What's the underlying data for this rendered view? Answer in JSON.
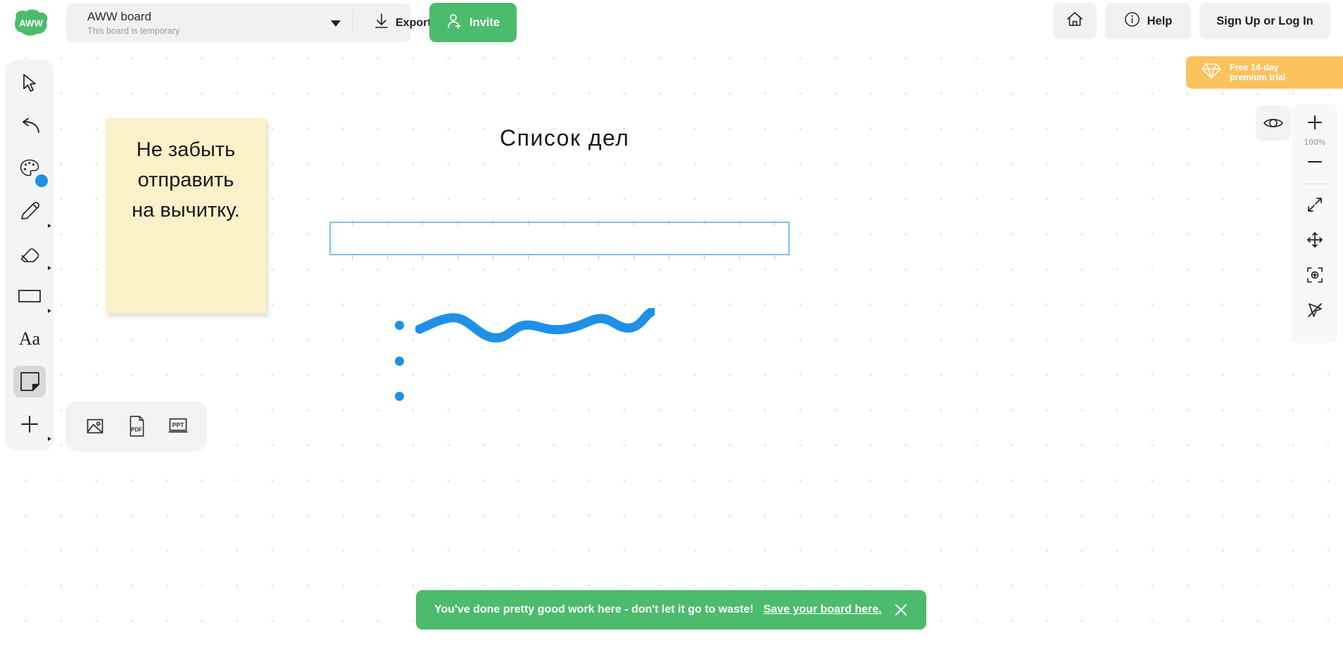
{
  "header": {
    "logo_text": "AWW",
    "board_title": "AWW board",
    "board_subtitle": "This board is temporary",
    "dropdown_icon": "chevron-down-icon",
    "export_label": "Export board",
    "export_icon": "download-icon",
    "invite_label": "Invite",
    "invite_icon": "add-user-icon",
    "home_icon": "home-icon",
    "help_label": "Help",
    "help_icon": "info-circle-icon",
    "signin_label": "Sign Up or Log In"
  },
  "premium": {
    "line1": "Free 14-day",
    "line2": "premium trial",
    "icon": "diamond-icon",
    "color": "#fbc25e"
  },
  "left_toolbar": {
    "tools": [
      {
        "name": "select-tool",
        "icon": "cursor-arrow-icon",
        "active": false,
        "has_arrow": false
      },
      {
        "name": "undo-tool",
        "icon": "undo-arrow-icon",
        "active": false,
        "has_arrow": false
      },
      {
        "name": "color-palette-tool",
        "icon": "palette-icon",
        "active": false,
        "has_arrow": false,
        "swatch_color": "#1e90e8"
      },
      {
        "name": "pencil-tool",
        "icon": "pencil-icon",
        "active": false,
        "has_arrow": true
      },
      {
        "name": "eraser-tool",
        "icon": "eraser-icon",
        "active": false,
        "has_arrow": true
      },
      {
        "name": "shape-tool",
        "icon": "rectangle-icon",
        "active": false,
        "has_arrow": true
      },
      {
        "name": "text-tool",
        "icon": "text-aa-icon",
        "active": false,
        "has_arrow": false,
        "label": "Aa"
      },
      {
        "name": "sticky-note-tool",
        "icon": "sticky-note-icon",
        "active": true,
        "has_arrow": false
      },
      {
        "name": "add-more-tool",
        "icon": "plus-icon",
        "active": false,
        "has_arrow": true
      }
    ]
  },
  "right_toolbar": {
    "zoom_in_icon": "plus-icon",
    "zoom_level": "100%",
    "zoom_out_icon": "minus-icon",
    "tools": [
      {
        "name": "fullscreen-tool",
        "icon": "expand-arrows-icon"
      },
      {
        "name": "pan-tool",
        "icon": "move-cross-arrows-icon"
      },
      {
        "name": "fit-to-screen-tool",
        "icon": "frame-plus-icon"
      },
      {
        "name": "laser-pointer-tool",
        "icon": "crossed-pointer-icon"
      }
    ],
    "visibility_icon": "eye-icon"
  },
  "canvas": {
    "heading": "Список дел",
    "sticky_note": {
      "text": "Не забыть\nотправить\nна вычитку.",
      "color": "#faf1c8"
    },
    "textbox": {
      "value": "",
      "placeholder": "",
      "border_color": "#7fc0ef"
    },
    "drawing": {
      "stroke_color": "#1e90e8",
      "name": "wavy-line"
    },
    "bullets": [
      {
        "name": "bullet-point-1",
        "color": "#1e90e8"
      },
      {
        "name": "bullet-point-2",
        "color": "#1e90e8"
      },
      {
        "name": "bullet-point-3",
        "color": "#1e90e8"
      }
    ],
    "upload_panel": {
      "items": [
        {
          "name": "upload-image-button",
          "icon": "image-icon",
          "label": ""
        },
        {
          "name": "upload-pdf-button",
          "icon": "pdf-file-icon",
          "label": "PDF"
        },
        {
          "name": "upload-ppt-button",
          "icon": "ppt-file-icon",
          "label": "PPT"
        }
      ]
    }
  },
  "toast": {
    "message": "You've done pretty good work here - don't let it go to waste!",
    "link": "Save your board here.",
    "close_icon": "close-icon",
    "color": "#4cbb6c"
  }
}
